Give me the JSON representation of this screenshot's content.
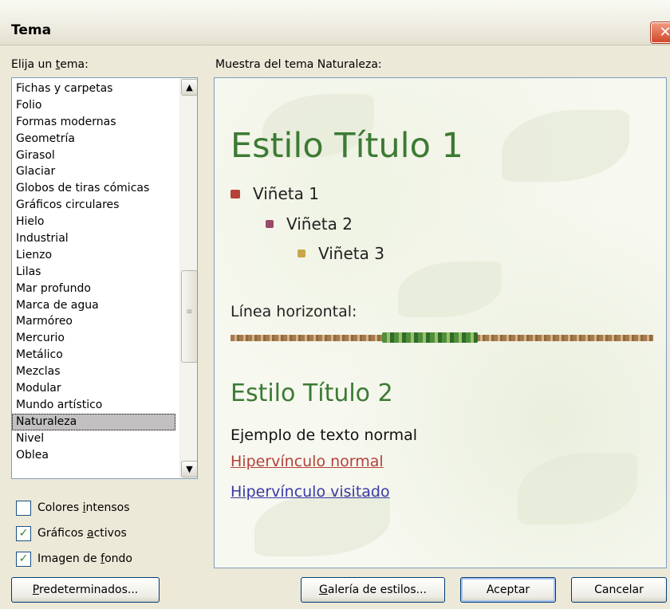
{
  "window": {
    "title": "Tema"
  },
  "left": {
    "label_prefix": "Elija un ",
    "label_u": "t",
    "label_suffix": "ema:",
    "themes": [
      "Fichas y carpetas",
      "Folio",
      "Formas modernas",
      "Geometría",
      "Girasol",
      "Glaciar",
      "Globos de tiras cómicas",
      "Gráficos circulares",
      "Hielo",
      "Industrial",
      "Lienzo",
      "Lilas",
      "Mar profundo",
      "Marca de agua",
      "Marmóreo",
      "Mercurio",
      "Metálico",
      "Mezclas",
      "Modular",
      "Mundo artístico",
      "Naturaleza",
      "Nivel",
      "Oblea"
    ],
    "selected": "Naturaleza",
    "scroll_up_icon": "chevron-up-icon",
    "scroll_down_icon": "chevron-down-icon"
  },
  "options": {
    "colores": {
      "pre": "Colores ",
      "u": "i",
      "post": "ntensos",
      "checked": false
    },
    "graficos": {
      "pre": "Gráficos ",
      "u": "a",
      "post": "ctivos",
      "checked": true
    },
    "imagen": {
      "pre": "Imagen de ",
      "u": "f",
      "post": "ondo",
      "checked": true
    }
  },
  "preview": {
    "label": "Muestra del tema Naturaleza:",
    "title1": "Estilo Título 1",
    "bullet1": "Viñeta 1",
    "bullet2": "Viñeta 2",
    "bullet3": "Viñeta 3",
    "hline_label": "Línea horizontal:",
    "title2": "Estilo Título 2",
    "normal_text": "Ejemplo de texto normal",
    "link": "Hipervínculo normal",
    "visited": "Hipervínculo visitado",
    "colors": {
      "heading": "#3c7a34",
      "link": "#b4413a",
      "visited": "#3a3aa8"
    }
  },
  "buttons": {
    "predeterminados": {
      "u": "P",
      "rest": "redeterminados..."
    },
    "galeria": {
      "u": "G",
      "rest": "alería de estilos..."
    },
    "aceptar": "Aceptar",
    "cancelar": "Cancelar"
  }
}
